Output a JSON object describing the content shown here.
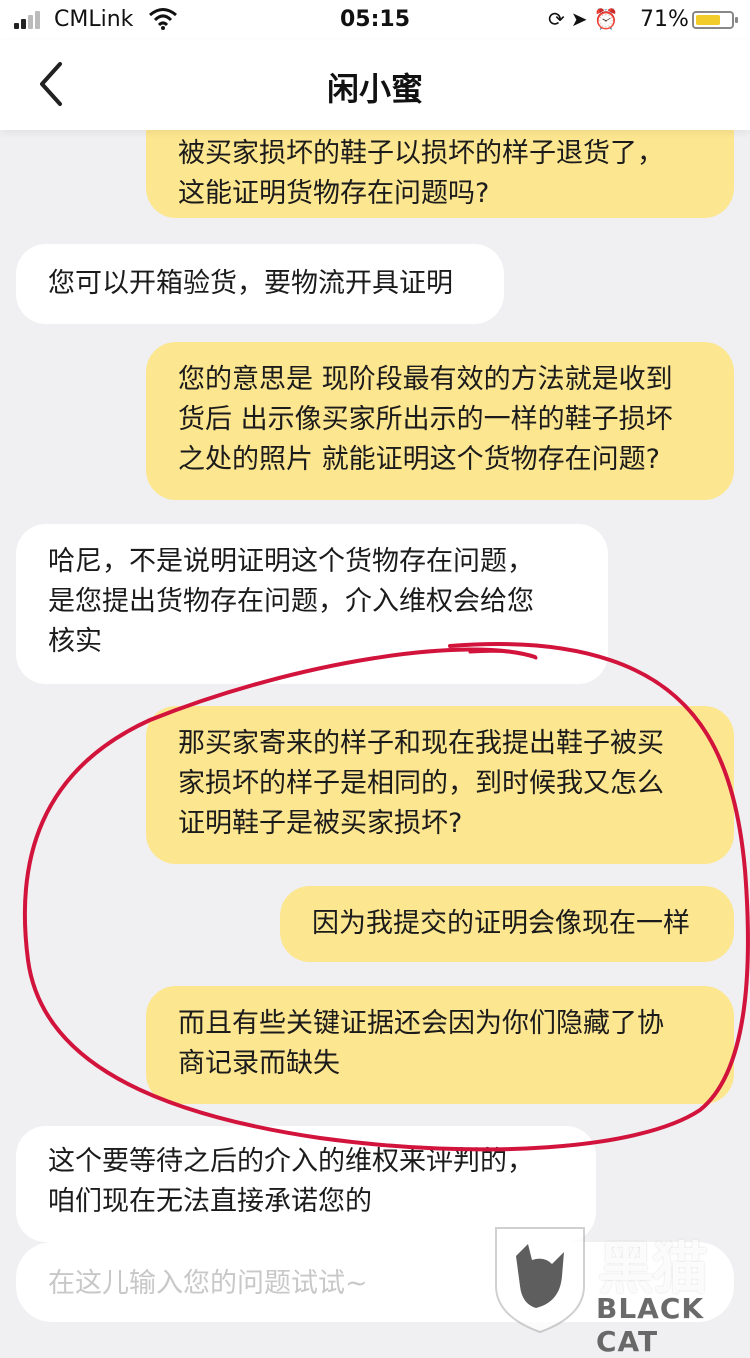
{
  "status_bar": {
    "carrier": "CMLink",
    "time": "05:15",
    "battery_percent": "71%",
    "battery_level": 0.71,
    "icons": [
      "signal-icon",
      "wifi-icon",
      "lock-rotation-icon",
      "location-icon",
      "alarm-icon",
      "battery-icon"
    ]
  },
  "nav": {
    "title": "闲小蜜",
    "back_icon": "chevron-left-icon"
  },
  "messages": [
    {
      "side": "mine",
      "text": "被买家损坏的鞋子以损坏的样子退货了，\n这能证明货物存在问题吗?"
    },
    {
      "side": "theirs",
      "text": "您可以开箱验货，要物流开具证明"
    },
    {
      "side": "mine",
      "text": "您的意思是 现阶段最有效的方法就是收到\n货后 出示像买家所出示的一样的鞋子损坏\n之处的照片 就能证明这个货物存在问题?"
    },
    {
      "side": "theirs",
      "text": "哈尼，不是说明证明这个货物存在问题，\n是您提出货物存在问题，介入维权会给您\n核实"
    },
    {
      "side": "mine",
      "text": "那买家寄来的样子和现在我提出鞋子被买\n家损坏的样子是相同的，到时候我又怎么\n证明鞋子是被买家损坏?"
    },
    {
      "side": "mine",
      "text": "因为我提交的证明会像现在一样"
    },
    {
      "side": "mine",
      "text": "而且有些关键证据还会因为你们隐藏了协\n商记录而缺失"
    },
    {
      "side": "theirs",
      "text": "这个要等待之后的介入的维权来评判的，\n咱们现在无法直接承诺您的"
    }
  ],
  "input": {
    "placeholder": "在这儿输入您的问题试试~",
    "value": ""
  },
  "watermark": {
    "cn": "黑猫",
    "en": "BLACK CAT"
  },
  "colors": {
    "my_bubble": "#fde690",
    "their_bubble": "#ffffff",
    "background": "#f0f0f2",
    "annotation": "#d2143c"
  }
}
